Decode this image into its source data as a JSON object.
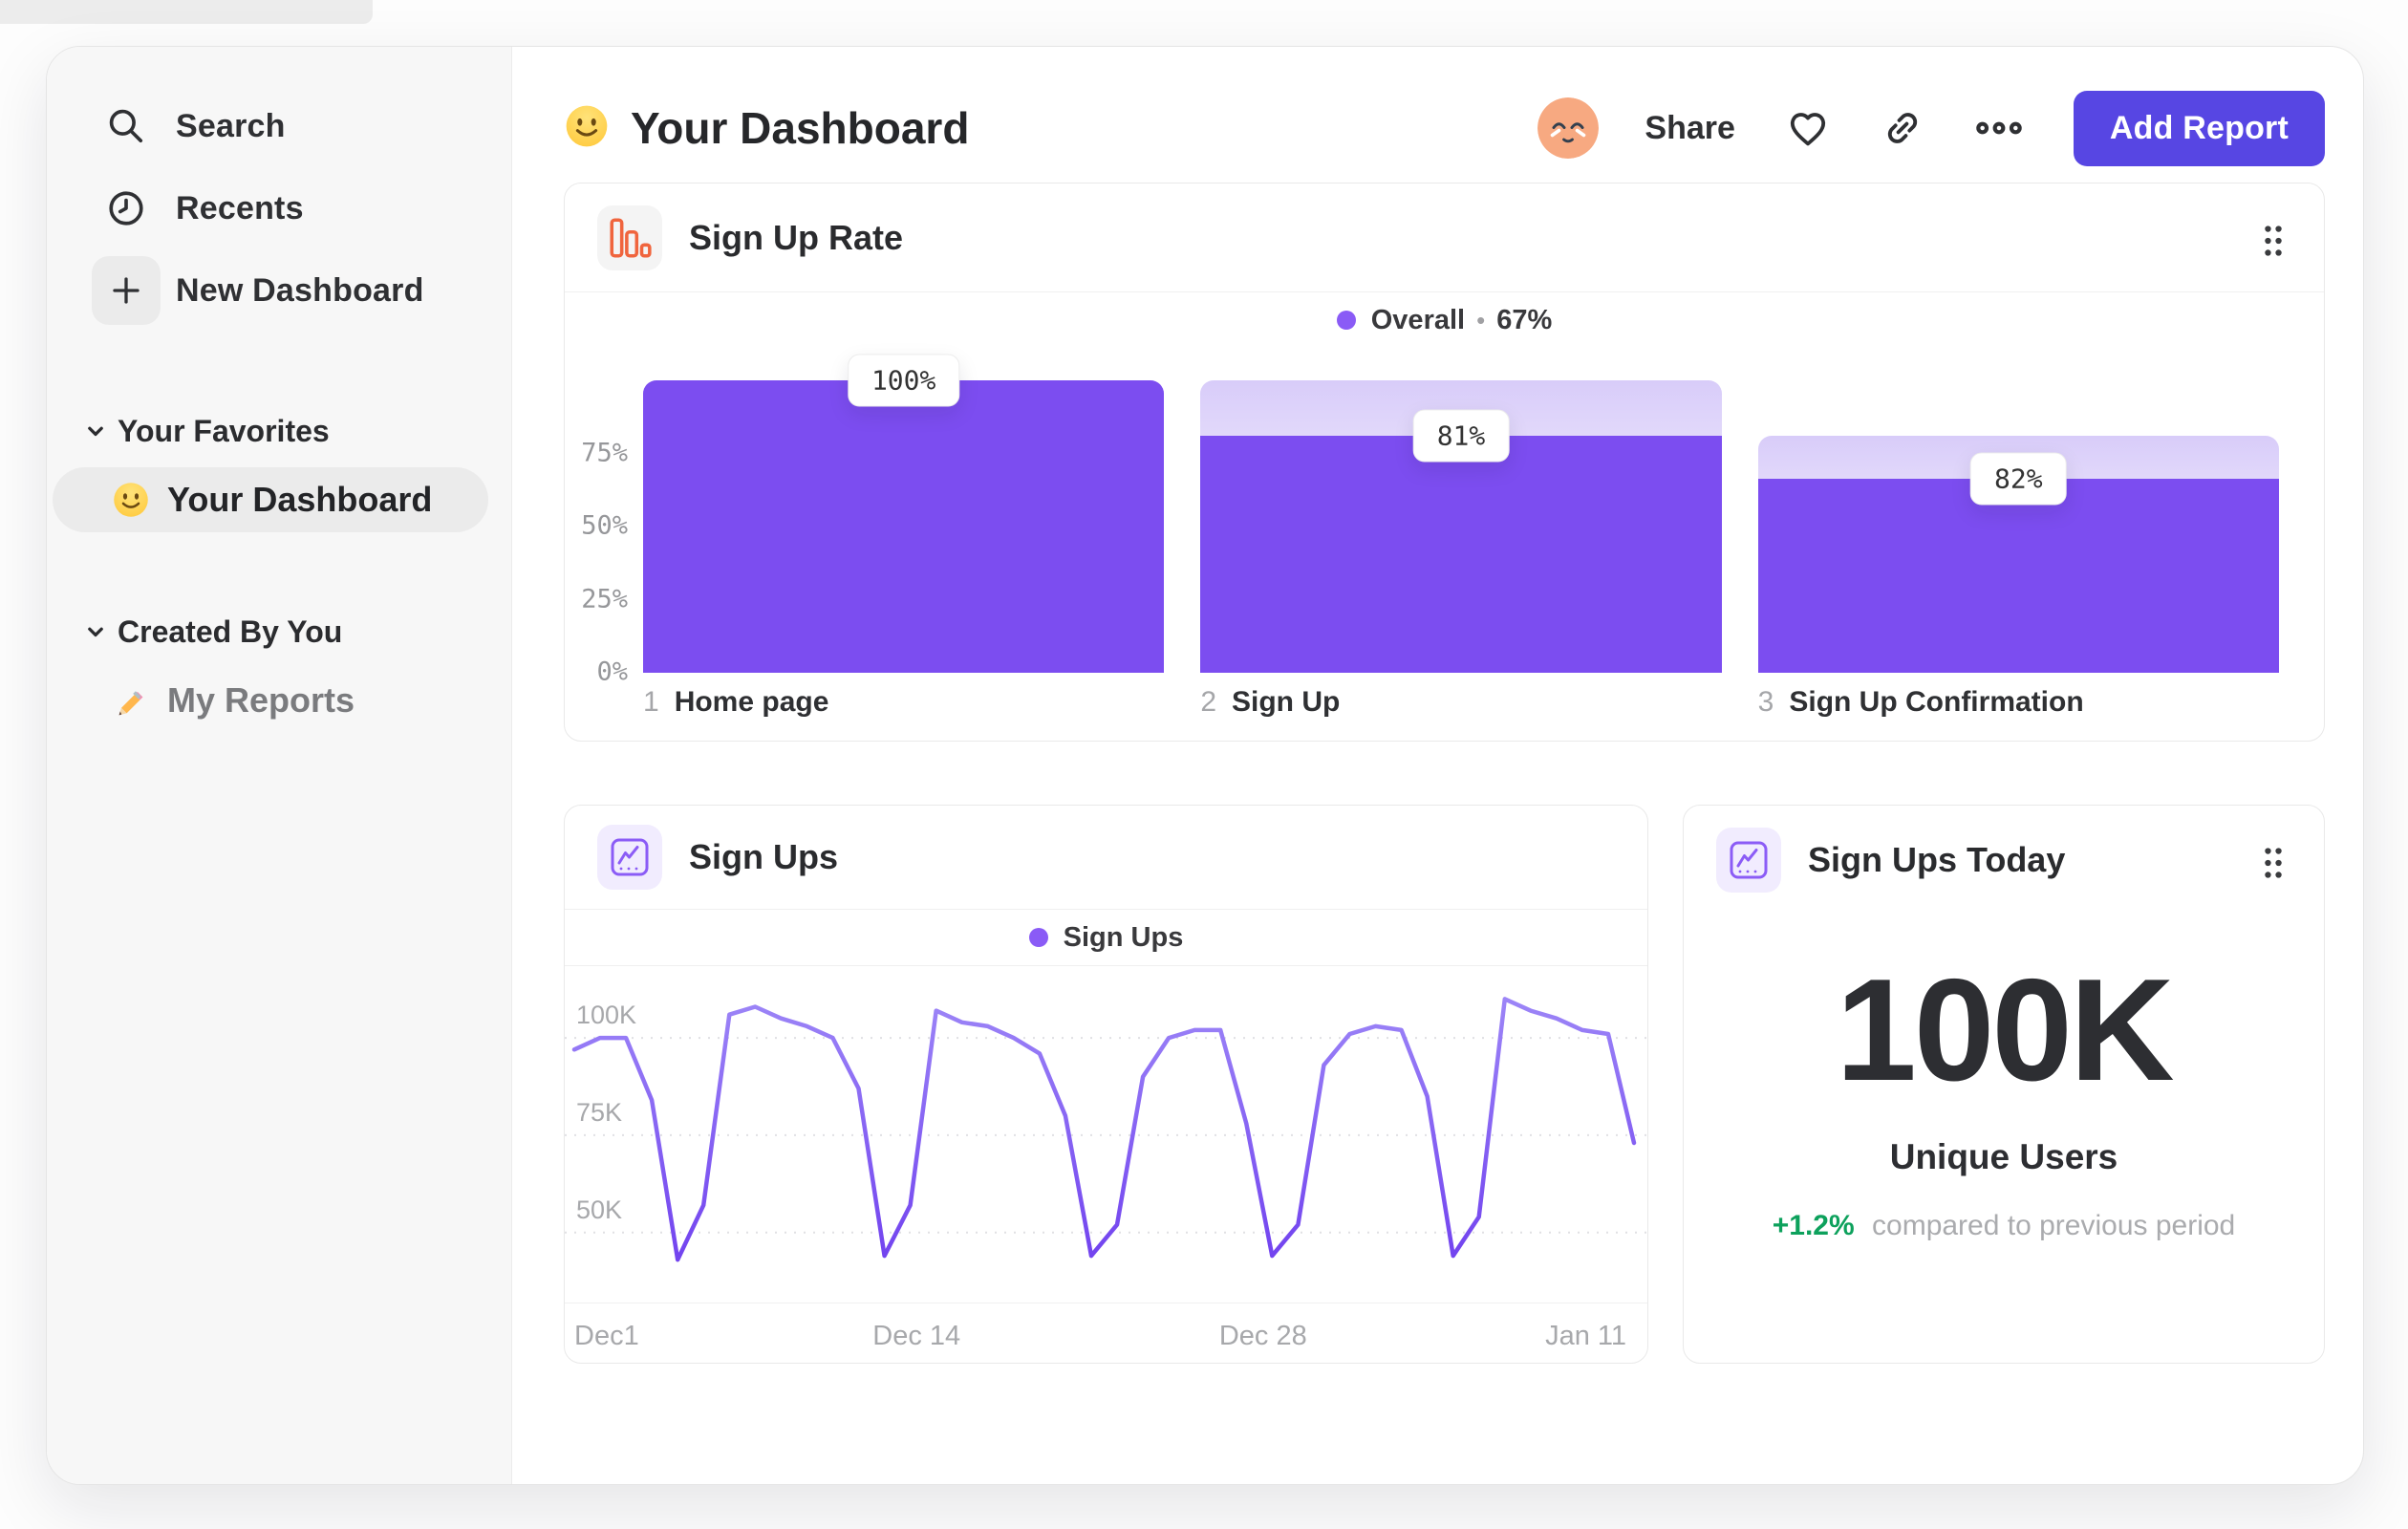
{
  "sidebar": {
    "items": [
      {
        "label": "Search",
        "icon": "search-icon"
      },
      {
        "label": "Recents",
        "icon": "clock-icon"
      },
      {
        "label": "New Dashboard",
        "icon": "plus-icon"
      }
    ],
    "sections": [
      {
        "label": "Your Favorites",
        "items": [
          {
            "label": "Your Dashboard",
            "icon": "smiley-emoji",
            "selected": true
          }
        ]
      },
      {
        "label": "Created By You",
        "items": [
          {
            "label": "My Reports",
            "icon": "pencil-emoji",
            "selected": false
          }
        ]
      }
    ]
  },
  "header": {
    "title": "Your Dashboard",
    "title_icon": "smiley-emoji",
    "share": "Share",
    "add_report": "Add Report",
    "icons": [
      "avatar",
      "heart-icon",
      "link-icon",
      "ellipsis-icon"
    ]
  },
  "cards": {
    "funnel": {
      "icon": "bar-chart-icon",
      "title": "Sign Up Rate",
      "legend": {
        "label": "Overall",
        "separator": "•",
        "value": "67%"
      },
      "y_ticks": [
        "75%",
        "50%",
        "25%",
        "0%"
      ],
      "steps": [
        {
          "num": "1",
          "label": "Home page"
        },
        {
          "num": "2",
          "label": "Sign Up"
        },
        {
          "num": "3",
          "label": "Sign Up Confirmation"
        }
      ]
    },
    "line": {
      "icon": "line-chart-icon",
      "title": "Sign Ups",
      "legend": "Sign Ups",
      "y_ticks": [
        "100K",
        "75K",
        "50K"
      ],
      "x_ticks": [
        "Dec1",
        "Dec 14",
        "Dec 28",
        "Jan 11"
      ]
    },
    "kpi": {
      "icon": "line-chart-icon",
      "title": "Sign Ups Today",
      "value": "100K",
      "label": "Unique Users",
      "delta": "+1.2%",
      "delta_suffix": "compared to previous period"
    }
  },
  "colors": {
    "accent_purple": "#7c4df0",
    "legend_dot": "#8a5bf6",
    "button_purple": "#5746e3",
    "icon_orange": "#f0653e",
    "positive_green": "#0da15c",
    "sidebar_bg": "#f7f7f7"
  },
  "chart_data": [
    {
      "type": "bar",
      "variant": "funnel",
      "title": "Sign Up Rate",
      "legend": [
        {
          "name": "Overall",
          "value": "67%"
        }
      ],
      "categories": [
        "Home page",
        "Sign Up",
        "Sign Up Confirmation"
      ],
      "values": [
        100,
        81,
        82
      ],
      "value_note": "each value is conversion % of previous step; cumulative: 100, 81, 66.4 (overall 67%)",
      "yticks": [
        "0%",
        "25%",
        "50%",
        "75%"
      ],
      "ylim": [
        0,
        100
      ],
      "grid": false,
      "legend_position": "top-center"
    },
    {
      "type": "line",
      "title": "Sign Ups",
      "legend": [
        "Sign Ups"
      ],
      "xlabel": "",
      "ylabel": "",
      "x_labels": [
        "Dec1",
        "Dec 14",
        "Dec 28",
        "Jan 11"
      ],
      "unit": "K",
      "values": [
        97,
        100,
        100,
        84,
        43,
        57,
        106,
        108,
        105,
        103,
        100,
        87,
        44,
        57,
        107,
        104,
        103,
        100,
        96,
        80,
        44,
        52,
        90,
        100,
        102,
        102,
        78,
        44,
        52,
        93,
        101,
        103,
        102,
        85,
        44,
        54,
        110,
        107,
        105,
        102,
        101,
        73
      ],
      "ylim": [
        32,
        115
      ],
      "grid_values": [
        100,
        75,
        50
      ],
      "grid_labels": [
        "100K",
        "75K",
        "50K"
      ],
      "grid": "dashed-horizontal",
      "legend_position": "top-center"
    }
  ]
}
